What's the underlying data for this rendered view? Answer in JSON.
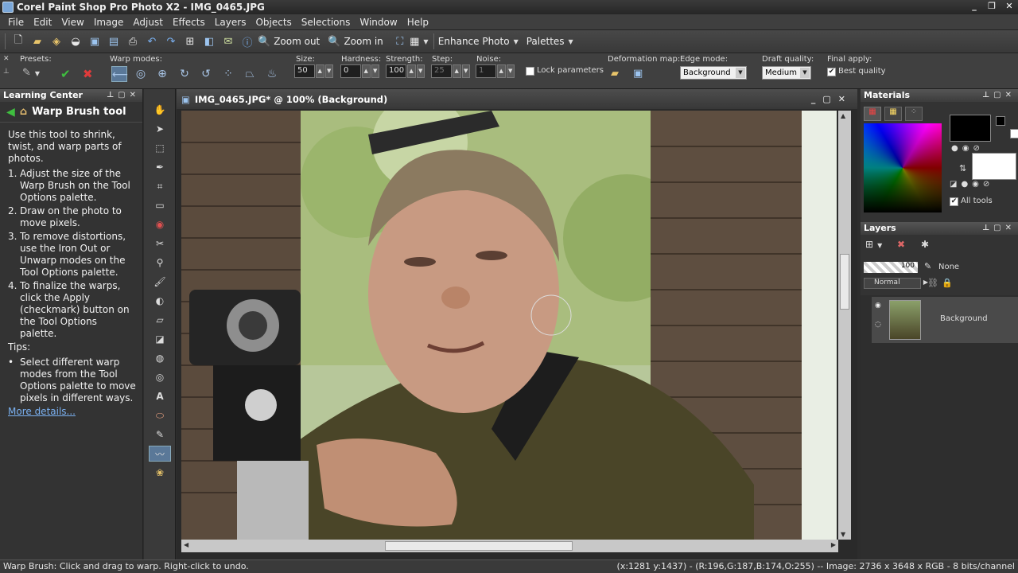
{
  "window": {
    "title": "Corel Paint Shop Pro Photo X2 - IMG_0465.JPG"
  },
  "menu": [
    "File",
    "Edit",
    "View",
    "Image",
    "Adjust",
    "Effects",
    "Layers",
    "Objects",
    "Selections",
    "Window",
    "Help"
  ],
  "toolbar": {
    "zoom_out": "Zoom out",
    "zoom_in": "Zoom in",
    "enhance_photo": "Enhance Photo",
    "palettes": "Palettes"
  },
  "options": {
    "presets_label": "Presets:",
    "warp_modes_label": "Warp modes:",
    "size_label": "Size:",
    "size_value": "50",
    "hardness_label": "Hardness:",
    "hardness_value": "0",
    "strength_label": "Strength:",
    "strength_value": "100",
    "step_label": "Step:",
    "step_value": "25",
    "noise_label": "Noise:",
    "noise_value": "1",
    "lock_parameters": "Lock parameters",
    "deformation_map_label": "Deformation map:",
    "edge_mode_label": "Edge mode:",
    "edge_mode_value": "Background",
    "draft_quality_label": "Draft quality:",
    "draft_quality_value": "Medium",
    "final_apply_label": "Final apply:",
    "best_quality": "Best quality"
  },
  "learning_center": {
    "panel_title": "Learning Center",
    "tool_title": "Warp Brush tool",
    "intro": "Use this tool to shrink, twist, and warp parts of photos.",
    "steps": [
      {
        "n": "1.",
        "text": "Adjust the size of the Warp Brush on the Tool Options palette."
      },
      {
        "n": "2.",
        "text": "Draw on the photo to move pixels."
      },
      {
        "n": "3.",
        "text": "To remove distortions, use the Iron Out or Unwarp modes on the Tool Options palette."
      },
      {
        "n": "4.",
        "text": "To finalize the warps, click the Apply (checkmark) button on the Tool Options palette."
      }
    ],
    "tips_label": "Tips:",
    "tip": "Select different warp modes from the Tool Options palette to move pixels in different ways.",
    "more": "More details..."
  },
  "document": {
    "title": "IMG_0465.JPG* @ 100% (Background)"
  },
  "materials": {
    "panel_title": "Materials",
    "all_tools": "All tools"
  },
  "layers": {
    "panel_title": "Layers",
    "opacity": "100",
    "mask": "None",
    "blend": "Normal",
    "layer_name": "Background"
  },
  "status": {
    "left": "Warp Brush: Click and drag to warp. Right-click to undo.",
    "right": "(x:1281 y:1437) - (R:196,G:187,B:174,O:255) -- Image:  2736 x 3648 x RGB - 8 bits/channel"
  }
}
